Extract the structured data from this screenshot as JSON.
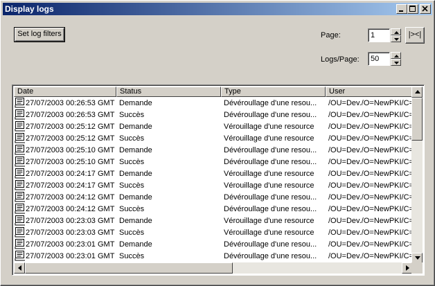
{
  "window": {
    "title": "Display logs"
  },
  "toolbar": {
    "filter_button_label": "Set log filters",
    "page_label": "Page:",
    "page_value": "1",
    "logs_per_page_label": "Logs/Page:",
    "logs_per_page_value": "50",
    "nav_button_label": "|><|"
  },
  "table": {
    "columns": [
      "Date",
      "Status",
      "Type",
      "User"
    ],
    "rows": [
      {
        "date": "27/07/2003 00:26:53 GMT",
        "status": "Demande",
        "type": "Dévéroullage d'une resou...",
        "user": "/OU=Dev./O=NewPKI/C="
      },
      {
        "date": "27/07/2003 00:26:53 GMT",
        "status": "Succès",
        "type": "Dévéroullage d'une resou...",
        "user": "/OU=Dev./O=NewPKI/C="
      },
      {
        "date": "27/07/2003 00:25:12 GMT",
        "status": "Demande",
        "type": "Vérouillage d'une resource",
        "user": "/OU=Dev./O=NewPKI/C="
      },
      {
        "date": "27/07/2003 00:25:12 GMT",
        "status": "Succès",
        "type": "Vérouillage d'une resource",
        "user": "/OU=Dev./O=NewPKI/C="
      },
      {
        "date": "27/07/2003 00:25:10 GMT",
        "status": "Demande",
        "type": "Dévéroullage d'une resou...",
        "user": "/OU=Dev./O=NewPKI/C="
      },
      {
        "date": "27/07/2003 00:25:10 GMT",
        "status": "Succès",
        "type": "Dévéroullage d'une resou...",
        "user": "/OU=Dev./O=NewPKI/C="
      },
      {
        "date": "27/07/2003 00:24:17 GMT",
        "status": "Demande",
        "type": "Vérouillage d'une resource",
        "user": "/OU=Dev./O=NewPKI/C="
      },
      {
        "date": "27/07/2003 00:24:17 GMT",
        "status": "Succès",
        "type": "Vérouillage d'une resource",
        "user": "/OU=Dev./O=NewPKI/C="
      },
      {
        "date": "27/07/2003 00:24:12 GMT",
        "status": "Demande",
        "type": "Dévéroullage d'une resou...",
        "user": "/OU=Dev./O=NewPKI/C="
      },
      {
        "date": "27/07/2003 00:24:12 GMT",
        "status": "Succès",
        "type": "Dévéroullage d'une resou...",
        "user": "/OU=Dev./O=NewPKI/C="
      },
      {
        "date": "27/07/2003 00:23:03 GMT",
        "status": "Demande",
        "type": "Vérouillage d'une resource",
        "user": "/OU=Dev./O=NewPKI/C="
      },
      {
        "date": "27/07/2003 00:23:03 GMT",
        "status": "Succès",
        "type": "Vérouillage d'une resource",
        "user": "/OU=Dev./O=NewPKI/C="
      },
      {
        "date": "27/07/2003 00:23:01 GMT",
        "status": "Demande",
        "type": "Dévéroullage d'une resou...",
        "user": "/OU=Dev./O=NewPKI/C="
      },
      {
        "date": "27/07/2003 00:23:01 GMT",
        "status": "Succès",
        "type": "Dévéroullage d'une resou...",
        "user": "/OU=Dev./O=NewPKI/C="
      }
    ]
  },
  "icons": {
    "row_icon": "log-entry-icon"
  },
  "colors": {
    "titlebar_start": "#0a246a",
    "titlebar_end": "#a6caf0",
    "face": "#d4d0c8"
  }
}
